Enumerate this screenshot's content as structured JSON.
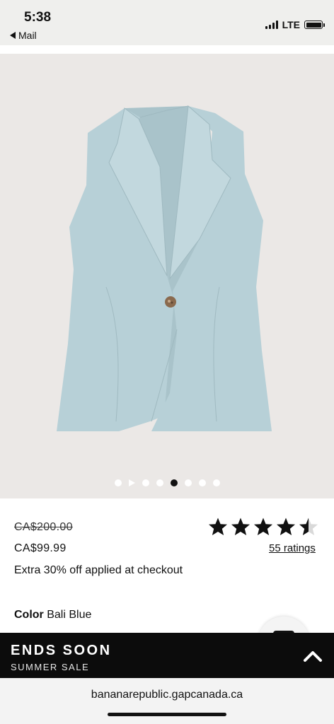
{
  "status_bar": {
    "time": "5:38",
    "back_app": "Mail",
    "network": "LTE",
    "battery_level": 1.0
  },
  "product": {
    "image_alt": "sleeveless light blue vest",
    "gallery": {
      "total": 8,
      "active_index": 4
    },
    "original_price": "CA$200.00",
    "sale_price": "CA$99.99",
    "promo": "Extra 30% off applied at checkout",
    "rating": 4.5,
    "rating_count": "55 ratings",
    "color_label": "Color",
    "color_value": "Bali Blue",
    "vest_color": "#b7d0d7",
    "image_bg": "#ebe8e6"
  },
  "sale_banner": {
    "title": "ENDS SOON",
    "subtitle": "SUMMER SALE"
  },
  "browser": {
    "url": "bananarepublic.gapcanada.ca"
  }
}
